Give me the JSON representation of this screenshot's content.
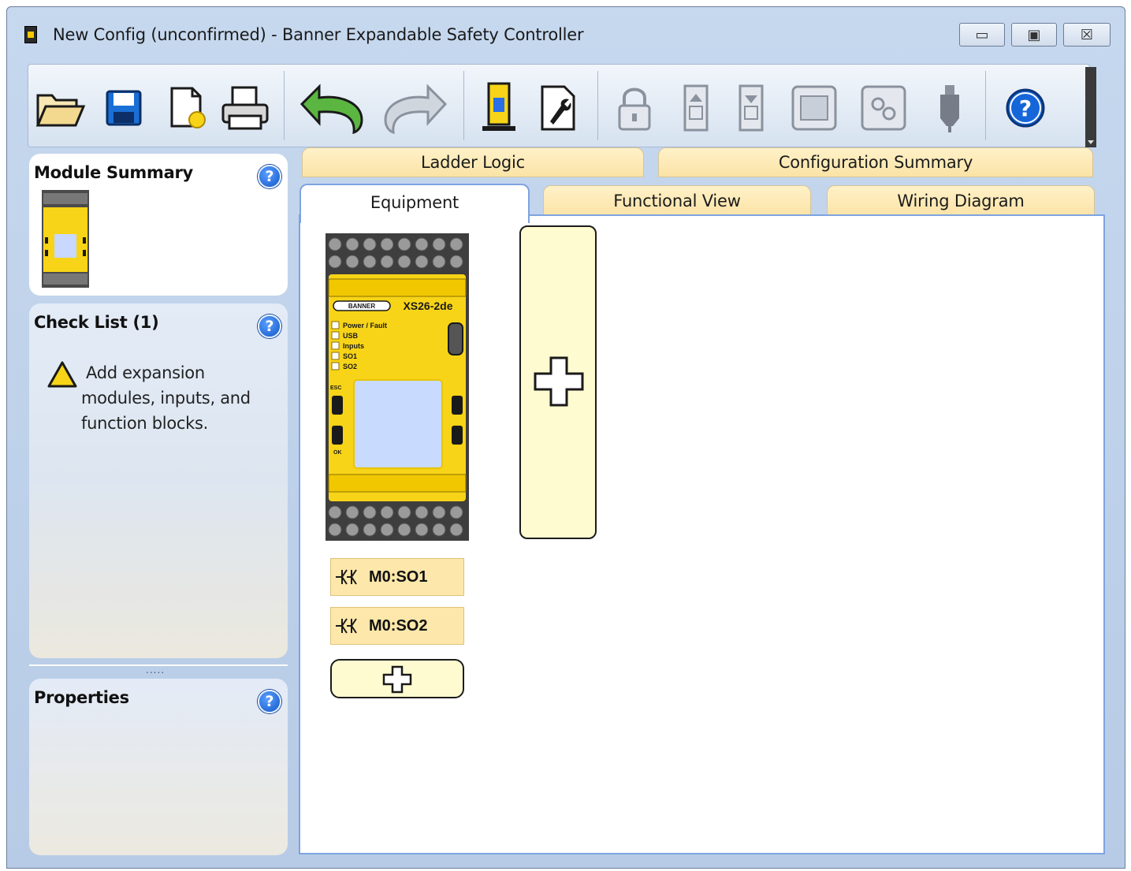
{
  "window": {
    "title": "New Config (unconfirmed) - Banner Expandable Safety Controller",
    "controls": {
      "minimize": "▭",
      "maximize": "▣",
      "close": "☒"
    }
  },
  "toolbar": {
    "buttons": [
      {
        "name": "open-folder-icon",
        "enabled": true
      },
      {
        "name": "save-icon",
        "enabled": true
      },
      {
        "name": "new-config-icon",
        "enabled": true
      },
      {
        "name": "print-icon",
        "enabled": true
      },
      {
        "name": "undo-icon",
        "enabled": true
      },
      {
        "name": "redo-icon",
        "enabled": false
      },
      {
        "name": "controller-icon",
        "enabled": true
      },
      {
        "name": "settings-document-icon",
        "enabled": true
      },
      {
        "name": "lock-icon",
        "enabled": false
      },
      {
        "name": "upload-icon",
        "enabled": false
      },
      {
        "name": "download-icon",
        "enabled": false
      },
      {
        "name": "module-icon",
        "enabled": false
      },
      {
        "name": "network-icon",
        "enabled": false
      },
      {
        "name": "usb-icon",
        "enabled": false
      },
      {
        "name": "help-icon",
        "enabled": true
      }
    ]
  },
  "sidebar": {
    "module_summary": {
      "title": "Module Summary"
    },
    "check_list": {
      "title": "Check List (1)",
      "message_lines": [
        "Add expansion",
        "modules, inputs, and",
        "function blocks."
      ]
    },
    "properties": {
      "title": "Properties"
    },
    "help_glyph": "?",
    "splitter_grip": "....."
  },
  "tabs": {
    "top": [
      "Ladder Logic",
      "Configuration Summary"
    ],
    "bottom": [
      "Equipment",
      "Functional View",
      "Wiring Diagram"
    ],
    "active": "Equipment"
  },
  "equipment": {
    "controller": {
      "brand": "BANNER",
      "model": "XS26-2de",
      "leds": [
        "Power / Fault",
        "USB",
        "Inputs",
        "SO1",
        "SO2"
      ],
      "buttons": [
        "ESC",
        "OK"
      ]
    },
    "outputs": [
      "M0:SO1",
      "M0:SO2"
    ]
  },
  "colors": {
    "accent_blue": "#7ea3e0",
    "tab_yellow": "#fbe3a6",
    "slot_yellow": "#fffbd0",
    "controller_yellow": "#f7d417"
  }
}
